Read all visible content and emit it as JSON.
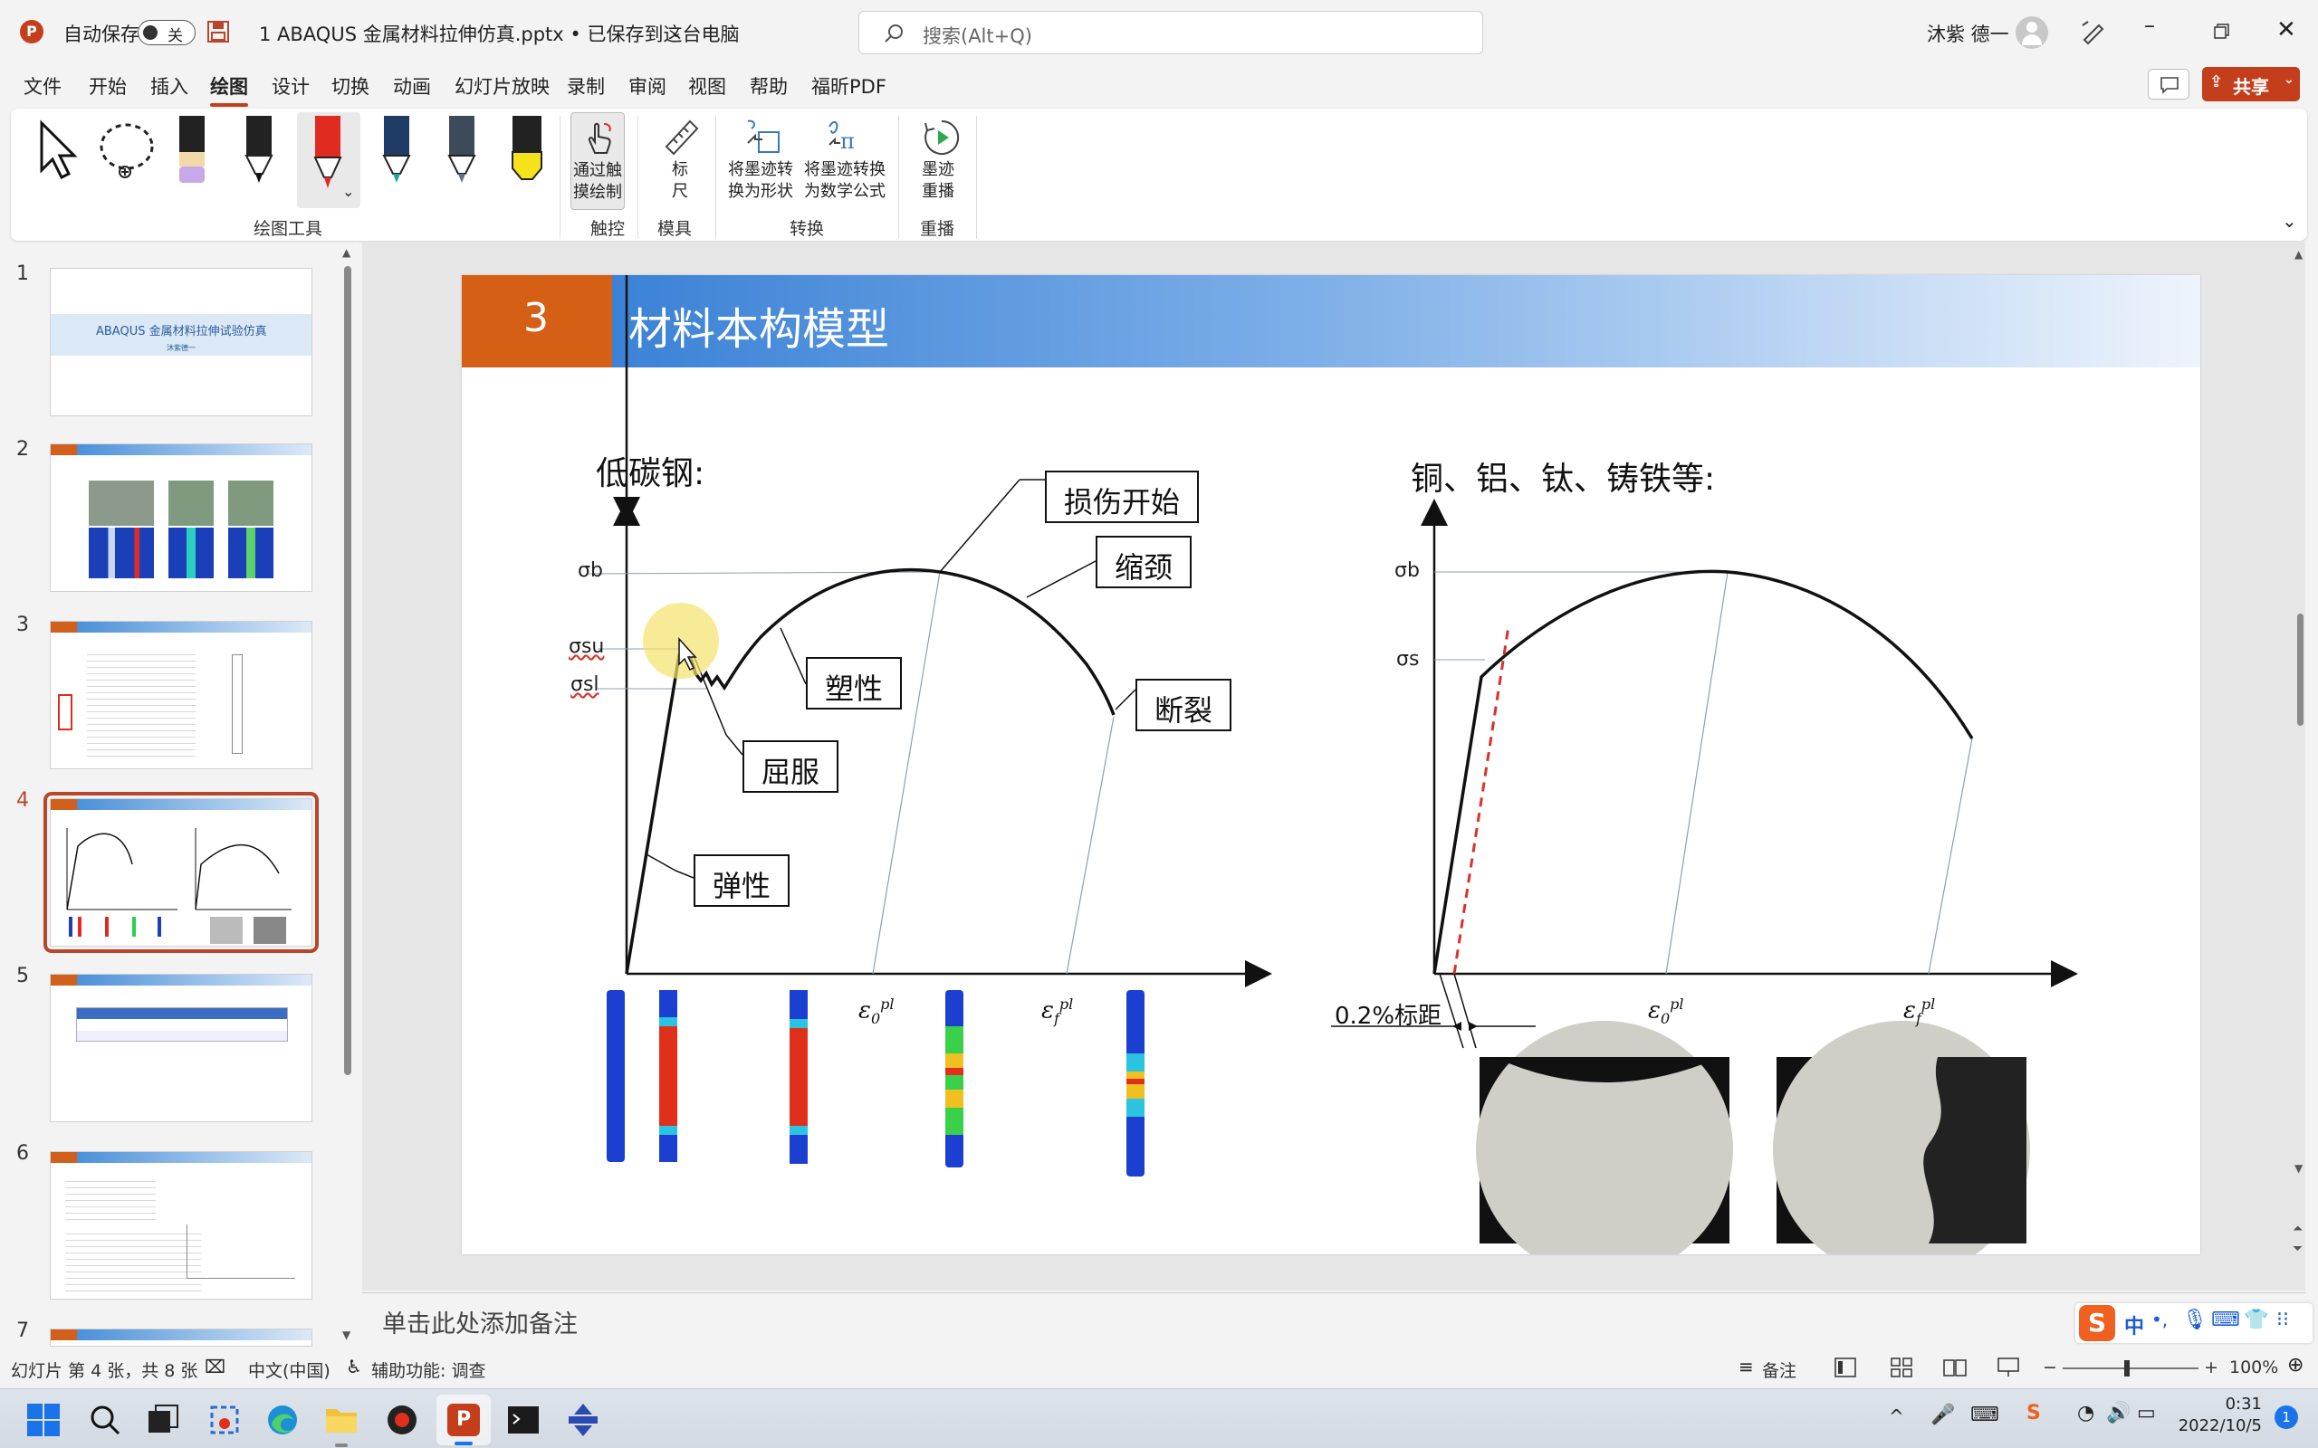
{
  "titlebar": {
    "autosave_label": "自动保存",
    "autosave_state": "关",
    "doc_title": "1 ABAQUS 金属材料拉伸仿真.pptx • 已保存到这台电脑",
    "search_placeholder": "搜索(Alt+Q)",
    "user_name": "沐紫 德一"
  },
  "menubar": {
    "items": [
      "文件",
      "开始",
      "插入",
      "绘图",
      "设计",
      "切换",
      "动画",
      "幻灯片放映",
      "录制",
      "审阅",
      "视图",
      "帮助",
      "福昕PDF"
    ],
    "active": "绘图",
    "share_label": "共享"
  },
  "ribbon": {
    "groups": {
      "draw_tools": "绘图工具",
      "touch": "触控",
      "stencils": "模具",
      "convert": "转换",
      "replay": "重播"
    },
    "buttons": {
      "touch_draw": [
        "通过触",
        "摸绘制"
      ],
      "ruler": [
        "标",
        "尺"
      ],
      "ink_to_shape": [
        "将墨迹转",
        "换为形状"
      ],
      "ink_to_math": [
        "将墨迹转换",
        "为数学公式"
      ],
      "ink_replay": [
        "墨迹",
        "重播"
      ]
    },
    "colors": {
      "pen_accent": "#e02b20",
      "highlighter": "#f5e21b"
    }
  },
  "thumbnails": {
    "numbers": [
      "1",
      "2",
      "3",
      "4",
      "5",
      "6",
      "7"
    ],
    "slide1_title": "ABAQUS 金属材料拉伸试验仿真",
    "slide1_author": "沐紫德一",
    "selected": 4
  },
  "slide": {
    "number": "3",
    "title": "材料本构模型",
    "left_heading": "低碳钢:",
    "right_heading": "铜、铝、钛、铸铁等:",
    "left_axis": {
      "sb": "σb",
      "ssu": "σsu",
      "ssl": "σsl"
    },
    "right_axis": {
      "sb": "σb",
      "ss": "σs"
    },
    "callouts": {
      "damage_start": "损伤开始",
      "necking": "缩颈",
      "plastic": "塑性",
      "fracture": "断裂",
      "yield": "屈服",
      "elastic": "弹性"
    },
    "offset_label": "0.2%标距",
    "eps0": {
      "base": "ε",
      "sup": "pl",
      "sub": "0"
    },
    "epsf": {
      "base": "ε",
      "sup": "pl",
      "sub": "f"
    },
    "colors": {
      "header_orange": "#d45f15",
      "header_blue": "#3b82d6",
      "dashed_red": "#d9322a"
    }
  },
  "notes": {
    "placeholder": "单击此处添加备注"
  },
  "statusbar": {
    "slide_info": "幻灯片 第 4 张，共 8 张",
    "language": "中文(中国)",
    "accessibility": "辅助功能: 调查",
    "notes_btn": "备注",
    "zoom": "100%"
  },
  "taskbar": {
    "time": "0:31",
    "date": "2022/10/5",
    "notification_count": "1",
    "ime": "中"
  }
}
